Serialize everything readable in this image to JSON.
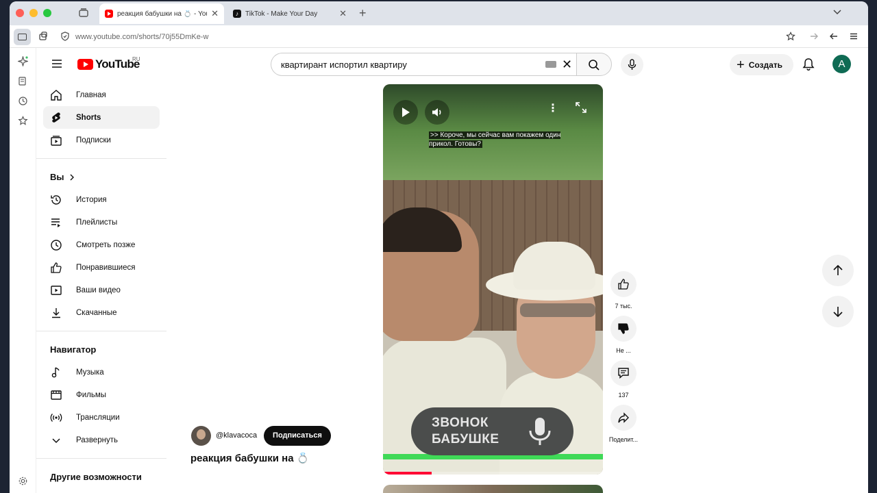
{
  "browser": {
    "tabs": [
      {
        "title": "реакция бабушки на 💍 - YouTube",
        "active": true
      },
      {
        "title": "TikTok - Make Your Day",
        "active": false
      }
    ],
    "url": "www.youtube.com/shorts/70j55DmKe-w"
  },
  "header": {
    "logo_text": "YouTube",
    "region": "RU",
    "search_value": "квартирант испортил квартиру",
    "create_label": "Создать",
    "avatar_letter": "A"
  },
  "sidebar": {
    "main": [
      {
        "label": "Главная",
        "icon": "home-icon"
      },
      {
        "label": "Shorts",
        "icon": "shorts-icon",
        "active": true
      },
      {
        "label": "Подписки",
        "icon": "subscriptions-icon"
      }
    ],
    "you_heading": "Вы",
    "you": [
      {
        "label": "История",
        "icon": "history-icon"
      },
      {
        "label": "Плейлисты",
        "icon": "playlists-icon"
      },
      {
        "label": "Смотреть позже",
        "icon": "watch-later-icon"
      },
      {
        "label": "Понравившиеся",
        "icon": "thumbs-up-icon"
      },
      {
        "label": "Ваши видео",
        "icon": "your-videos-icon"
      },
      {
        "label": "Скачанные",
        "icon": "download-icon"
      }
    ],
    "navigator_heading": "Навигатор",
    "navigator": [
      {
        "label": "Музыка",
        "icon": "music-icon"
      },
      {
        "label": "Фильмы",
        "icon": "film-icon"
      },
      {
        "label": "Трансляции",
        "icon": "live-icon"
      },
      {
        "label": "Развернуть",
        "icon": "chevron-down-icon"
      }
    ],
    "more_heading": "Другие возможности"
  },
  "video": {
    "caption": ">> Короче, мы сейчас вам покажем один прикол. Готовы?",
    "sticker_line1": "ЗВОНОК",
    "sticker_line2": "БАБУШКЕ",
    "progress_fraction": 0.22
  },
  "actions": {
    "likes": "7 тыс.",
    "dislike": "Не ...",
    "comments": "137",
    "share": "Поделит..."
  },
  "channel": {
    "handle": "@klavacoca",
    "subscribe_label": "Подписаться",
    "title": "реакция бабушки на 💍"
  },
  "colors": {
    "brand": "#ff0000",
    "accent_green": "#3fd957",
    "progress": "#ff0033"
  }
}
